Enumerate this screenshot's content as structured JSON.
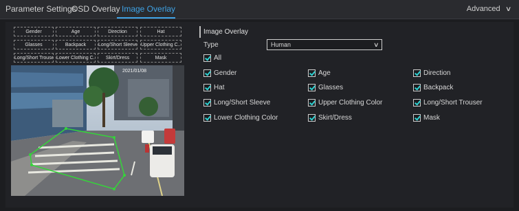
{
  "tabs": [
    {
      "label": "Parameter Settings"
    },
    {
      "label": "OSD Overlay"
    },
    {
      "label": "Image Overlay"
    }
  ],
  "advanced_label": "Advanced",
  "accent_color": "#3fa3e6",
  "preview": {
    "attribute_tags": [
      "Gender",
      "Age",
      "Direction",
      "Hat",
      "Glasses",
      "Backpack",
      "Long/Short Sleeve",
      "Upper Clothing C...",
      "Long/Short Trouser",
      "Lower Clothing C...",
      "Skirt/Dress",
      "Mask"
    ],
    "camera_caption": "2021/01/08"
  },
  "settings": {
    "section_title": "Image Overlay",
    "type_label": "Type",
    "type_value": "Human",
    "all_label": "All",
    "checkboxes": [
      {
        "label": "Gender",
        "checked": true
      },
      {
        "label": "Age",
        "checked": true
      },
      {
        "label": "Direction",
        "checked": true
      },
      {
        "label": "Hat",
        "checked": true
      },
      {
        "label": "Glasses",
        "checked": true
      },
      {
        "label": "Backpack",
        "checked": true
      },
      {
        "label": "Long/Short Sleeve",
        "checked": true
      },
      {
        "label": "Upper Clothing Color",
        "checked": true
      },
      {
        "label": "Long/Short Trouser",
        "checked": true
      },
      {
        "label": "Lower Clothing Color",
        "checked": true
      },
      {
        "label": "Skirt/Dress",
        "checked": true
      },
      {
        "label": "Mask",
        "checked": true
      }
    ]
  }
}
